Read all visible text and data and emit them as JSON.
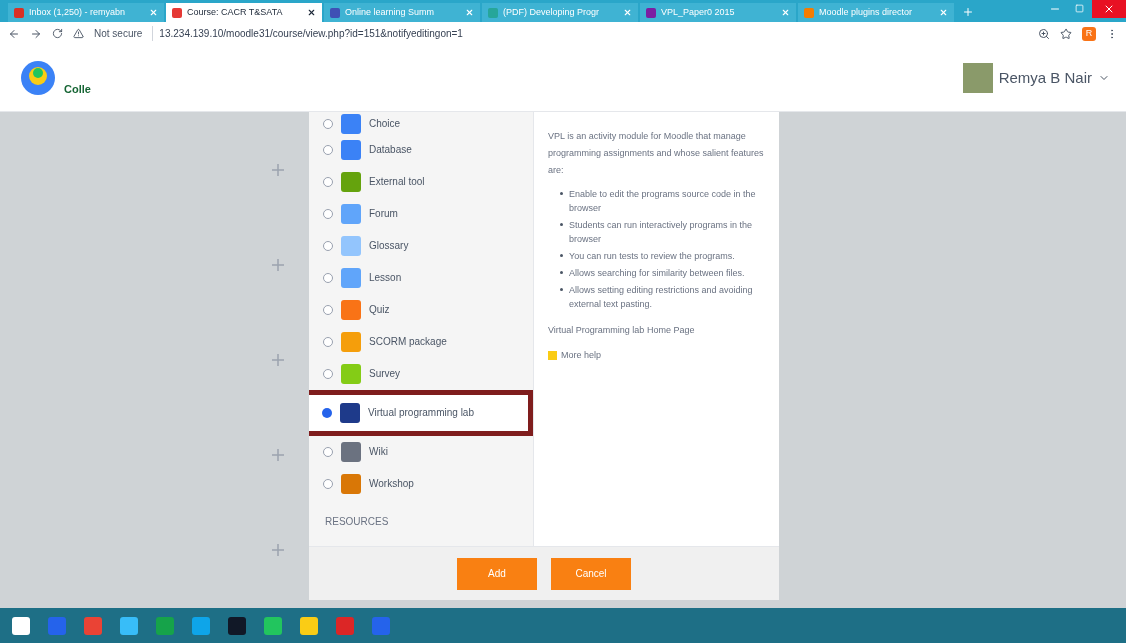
{
  "browser": {
    "tabs": [
      {
        "title": "Inbox (1,250) - remyabn",
        "selected": false,
        "kind": "mail"
      },
      {
        "title": "Course: CACR T&SATA",
        "selected": true,
        "kind": "moodle"
      },
      {
        "title": "Online learning Summ",
        "selected": false,
        "kind": "k"
      },
      {
        "title": "(PDF) Developing Progr",
        "selected": false,
        "kind": "pdf"
      },
      {
        "title": "VPL_Paper0 2015",
        "selected": false,
        "kind": "vpl"
      },
      {
        "title": "Moodle plugins director",
        "selected": false,
        "kind": "plugin"
      }
    ],
    "security": "Not secure",
    "url": "13.234.139.10/moodle31/course/view.php?id=151&notifyeditingon=1",
    "profile_initial": "R"
  },
  "header": {
    "logo_text": "Colle",
    "user": "Remya B Nair"
  },
  "chooser": {
    "activities": [
      {
        "name": "Choice",
        "selected": false
      },
      {
        "name": "Database",
        "selected": false
      },
      {
        "name": "External tool",
        "selected": false
      },
      {
        "name": "Forum",
        "selected": false
      },
      {
        "name": "Glossary",
        "selected": false
      },
      {
        "name": "Lesson",
        "selected": false
      },
      {
        "name": "Quiz",
        "selected": false
      },
      {
        "name": "SCORM package",
        "selected": false
      },
      {
        "name": "Survey",
        "selected": false
      },
      {
        "name": "Virtual programming lab",
        "selected": true
      },
      {
        "name": "Wiki",
        "selected": false
      },
      {
        "name": "Workshop",
        "selected": false
      }
    ],
    "section_heading": "RESOURCES",
    "description": "VPL is an activity module for Moodle that manage programming assignments and whose salient features are:",
    "features": [
      "Enable to edit the programs source code in the browser",
      "Students can run interactively programs in the browser",
      "You can run tests to review the programs.",
      "Allows searching for similarity between files.",
      "Allows setting editing restrictions and avoiding external text pasting."
    ],
    "home_link": "Virtual Programming lab Home Page",
    "more_help": "More help",
    "buttons": [
      "Add",
      "Cancel"
    ]
  }
}
